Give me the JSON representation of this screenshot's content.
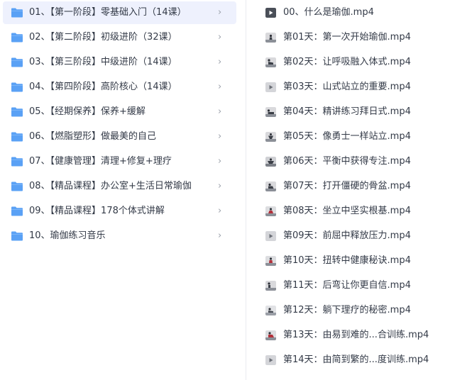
{
  "folders": [
    {
      "label": "01、【第一阶段】零基础入门（14课）",
      "selected": true
    },
    {
      "label": "02、【第二阶段】初级进阶（32课）",
      "selected": false
    },
    {
      "label": "03、【第三阶段】中级进阶（14课）",
      "selected": false
    },
    {
      "label": "04、【第四阶段】高阶核心（14课）",
      "selected": false
    },
    {
      "label": "05、【经期保养】保养+缓解",
      "selected": false
    },
    {
      "label": "06、【燃脂塑形】做最美的自己",
      "selected": false
    },
    {
      "label": "07、【健康管理】清理+修复+理疗",
      "selected": false
    },
    {
      "label": "08、【精品课程】办公室+生活日常瑜伽",
      "selected": false
    },
    {
      "label": "09、【精品课程】178个体式讲解",
      "selected": false
    },
    {
      "label": "10、瑜伽练习音乐",
      "selected": false
    }
  ],
  "chevron": "›",
  "files": [
    {
      "label": "00、什么是瑜伽.mp4"
    },
    {
      "label": "第01天：第一次开始瑜伽.mp4"
    },
    {
      "label": "第02天：让呼吸融入体式.mp4"
    },
    {
      "label": "第03天：山式站立的重要.mp4"
    },
    {
      "label": "第04天：精讲练习拜日式.mp4"
    },
    {
      "label": "第05天：像勇士一样站立.mp4"
    },
    {
      "label": "第06天：平衡中获得专注.mp4"
    },
    {
      "label": "第07天：打开僵硬的骨盆.mp4"
    },
    {
      "label": "第08天：坐立中坚实根基.mp4"
    },
    {
      "label": "第09天：前屈中释放压力.mp4"
    },
    {
      "label": "第10天：扭转中健康秘诀.mp4"
    },
    {
      "label": "第11天：后弯让你更自信.mp4"
    },
    {
      "label": "第12天：躺下理疗的秘密.mp4"
    },
    {
      "label": "第13天：由易到难的...合训练.mp4"
    },
    {
      "label": "第14天：由简到繁的...度训练.mp4"
    }
  ],
  "colors": {
    "folder": "#5aa1f5",
    "selected_bg": "#eef1fd",
    "text": "#333a47"
  }
}
